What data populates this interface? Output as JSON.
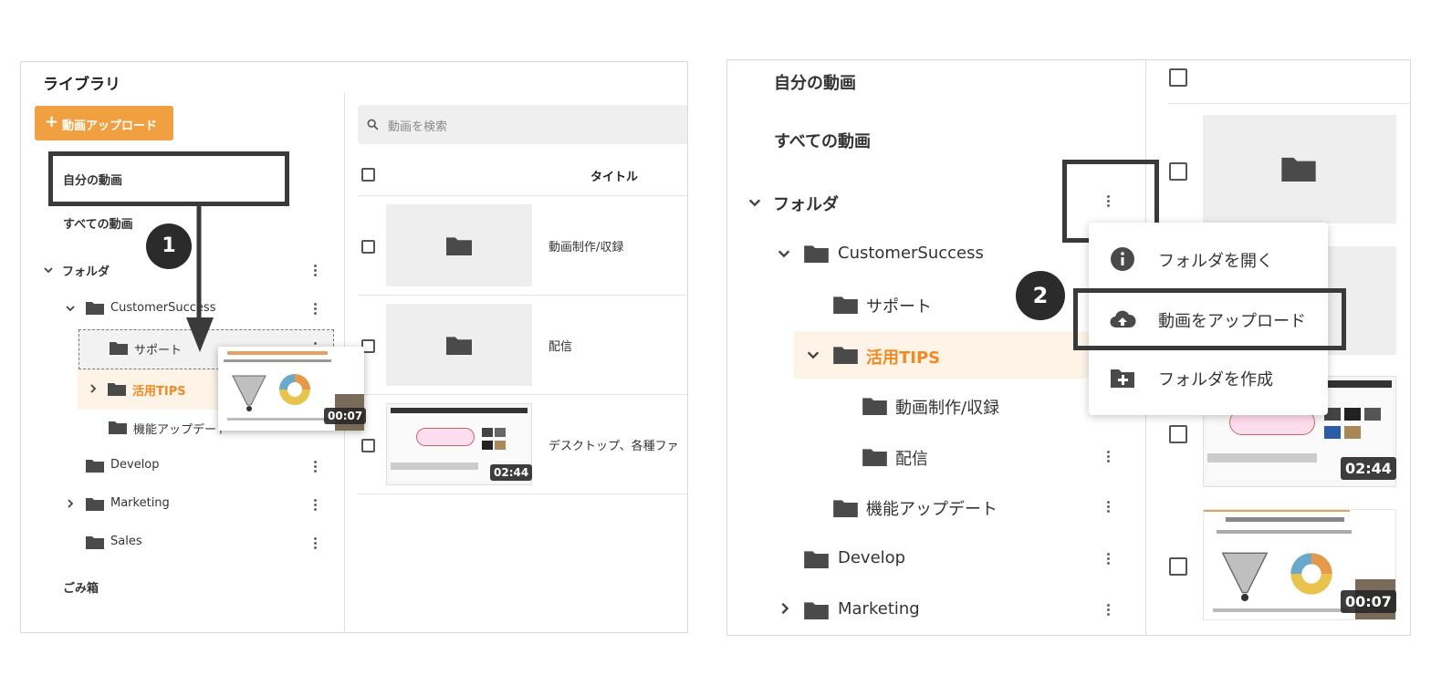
{
  "left": {
    "library_title": "ライブラリ",
    "upload_button": "動画アップロード",
    "nav": {
      "my_videos": "自分の動画",
      "all_videos": "すべての動画",
      "folders": "フォルダ",
      "trash": "ごみ箱"
    },
    "tree": {
      "customer_success": "CustomerSuccess",
      "support": "サポート",
      "tips": "活用TIPS",
      "feature_update": "機能アップデート",
      "develop": "Develop",
      "marketing": "Marketing",
      "sales": "Sales"
    },
    "search_placeholder": "動画を検索",
    "column_title": "タイトル",
    "rows": [
      {
        "title": "動画制作/収録"
      },
      {
        "title": "配信"
      },
      {
        "title": "デスクトップ、各種ファ",
        "duration": "02:44"
      }
    ],
    "drag_duration": "00:07",
    "step_number": "1"
  },
  "right": {
    "nav": {
      "my_videos": "自分の動画",
      "all_videos": "すべての動画",
      "folders": "フォルダ"
    },
    "tree": {
      "customer_success": "CustomerSuccess",
      "support": "サポート",
      "tips": "活用TIPS",
      "production": "動画制作/収録",
      "distribution": "配信",
      "feature_update": "機能アップデート",
      "develop": "Develop",
      "marketing": "Marketing"
    },
    "menu": {
      "open_folder": "フォルダを開く",
      "upload_video": "動画をアップロード",
      "create_folder": "フォルダを作成"
    },
    "durations": [
      "02:44",
      "00:07"
    ],
    "step_number": "2"
  },
  "colors": {
    "accent_orange": "#f0a040",
    "tips_text": "#f08a24",
    "tips_highlight": "#fdf3e7",
    "folder_icon": "#4a4a4a",
    "marker": "#3a3a3a"
  }
}
